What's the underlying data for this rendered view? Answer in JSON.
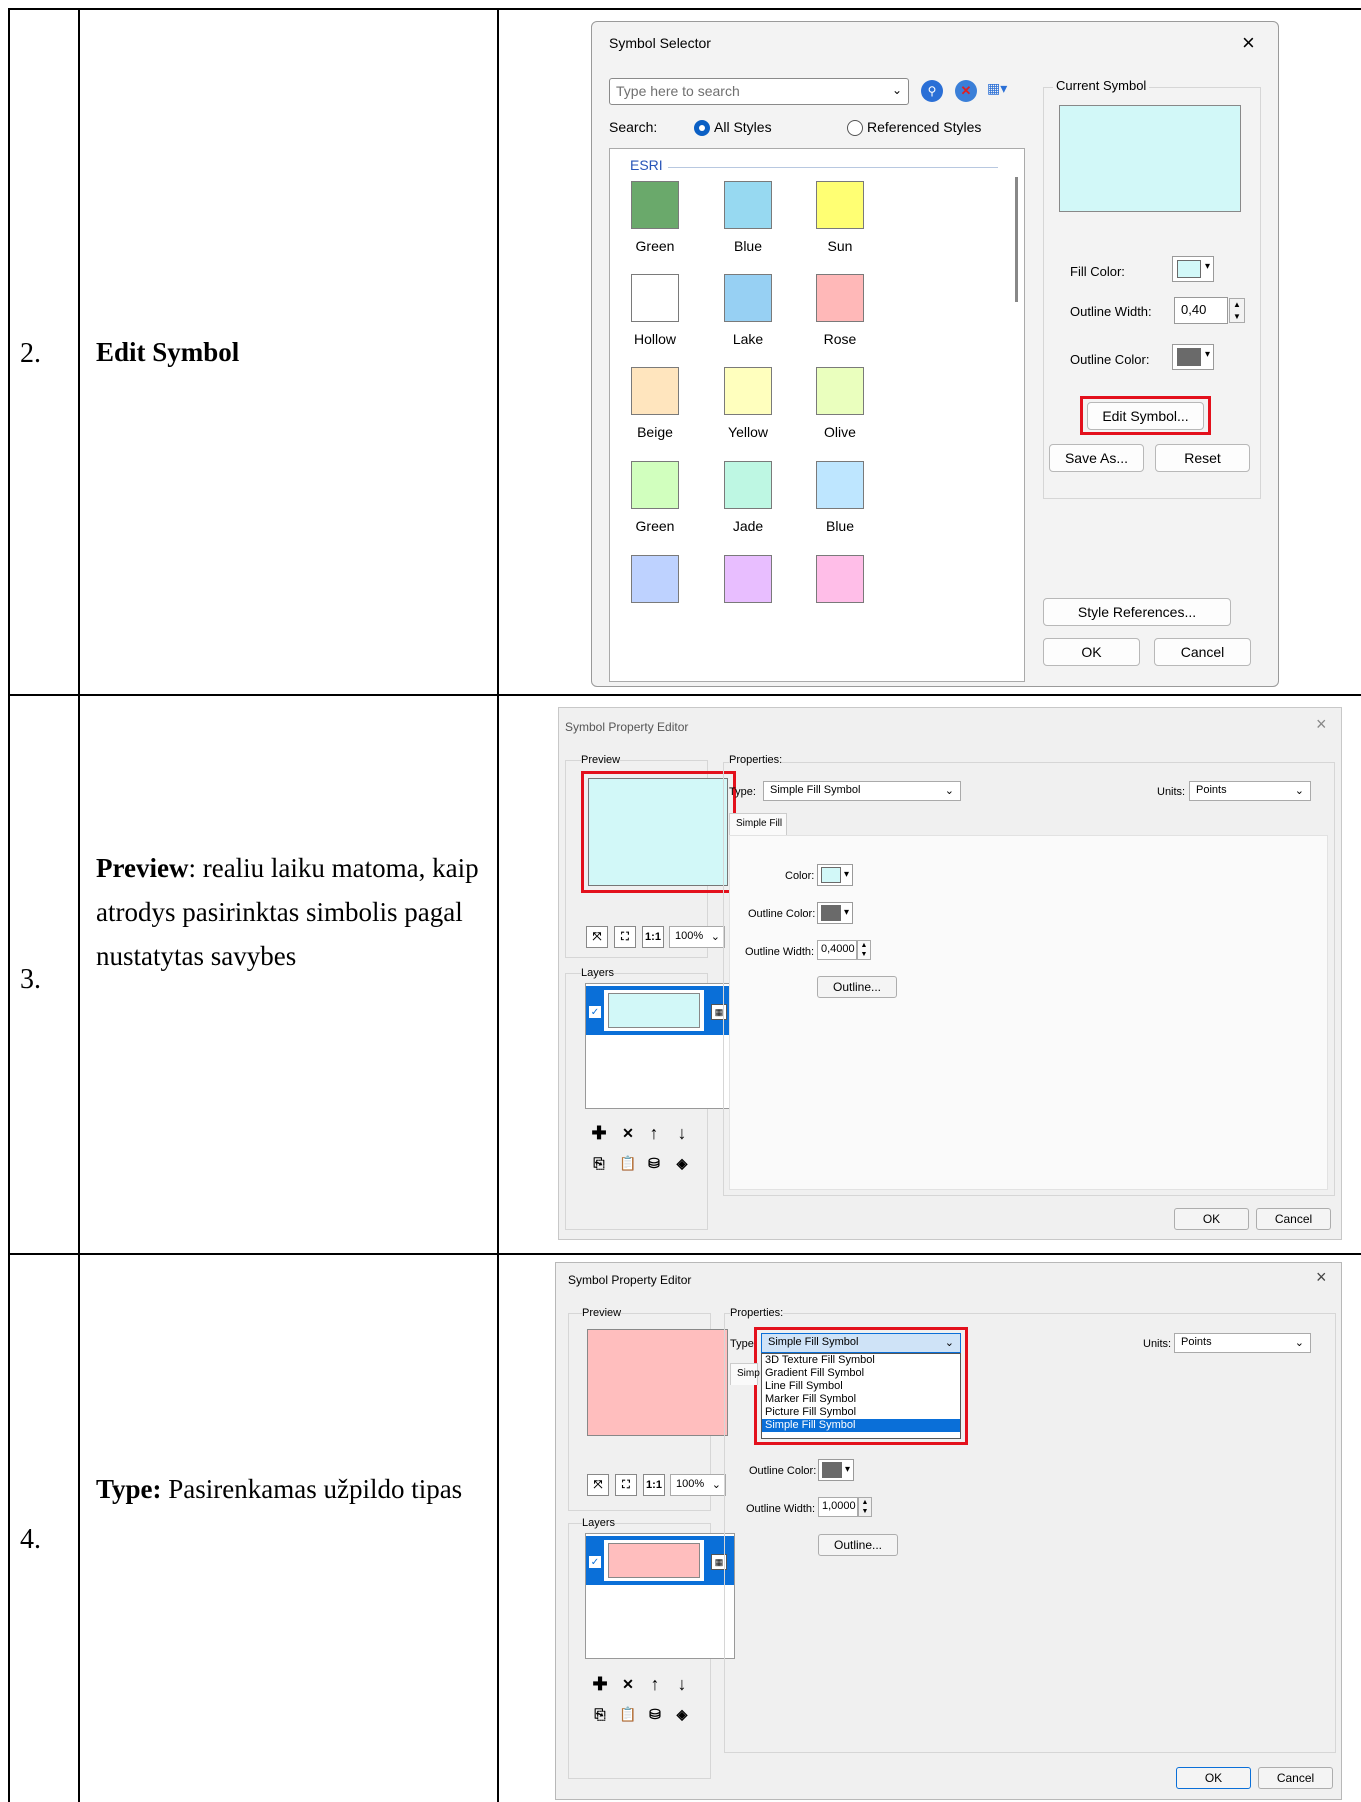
{
  "rows": [
    {
      "number": "2.",
      "title": "Edit Symbol",
      "text": ""
    },
    {
      "number": "3.",
      "title": "Preview",
      "text": ": realiu laiku matoma, kaip atrodys pasirinktas simbolis pagal nustatytas savybes"
    },
    {
      "number": "4.",
      "title": "Type:",
      "text": " Pasirenkamas užpildo tipas"
    }
  ],
  "symbol_selector": {
    "title": "Symbol Selector",
    "close": "×",
    "search_placeholder": "Type here to search",
    "search_label": "Search:",
    "opt_all": "All Styles",
    "opt_ref": "Referenced Styles",
    "group": "ESRI",
    "swatches": [
      {
        "label": "Green",
        "color": "#6aa96b"
      },
      {
        "label": "Blue",
        "color": "#97d9f1"
      },
      {
        "label": "Sun",
        "color": "#ffff73"
      },
      {
        "label": "Hollow",
        "color": "#ffffff"
      },
      {
        "label": "Lake",
        "color": "#97d0f3"
      },
      {
        "label": "Rose",
        "color": "#ffb8b8"
      },
      {
        "label": "Beige",
        "color": "#ffe5be"
      },
      {
        "label": "Yellow",
        "color": "#ffffbe"
      },
      {
        "label": "Olive",
        "color": "#eaffbe"
      },
      {
        "label": "Green",
        "color": "#d1ffbe"
      },
      {
        "label": "Jade",
        "color": "#bef7e3"
      },
      {
        "label": "Blue",
        "color": "#bee6ff"
      },
      {
        "label": "",
        "color": "#bed2ff"
      },
      {
        "label": "",
        "color": "#e8beff"
      },
      {
        "label": "",
        "color": "#ffbee8"
      }
    ],
    "current_symbol": "Current Symbol",
    "current_color": "#d2f8f8",
    "fill_color": "Fill Color:",
    "outline_width": "Outline Width:",
    "outline_width_value": "0,40",
    "outline_color": "Outline Color:",
    "edit_symbol": "Edit Symbol...",
    "save_as": "Save As...",
    "reset": "Reset",
    "style_refs": "Style References...",
    "ok": "OK",
    "cancel": "Cancel"
  },
  "editor1": {
    "title": "Symbol Property Editor",
    "close": "×",
    "preview": "Preview",
    "properties": "Properties:",
    "type_label": "Type:",
    "type_value": "Simple Fill Symbol",
    "units_label": "Units:",
    "units_value": "Points",
    "tab": "Simple Fill",
    "color_label": "Color:",
    "outline_color_label": "Outline Color:",
    "outline_width_label": "Outline Width:",
    "outline_width_value": "0,4000",
    "outline_btn": "Outline...",
    "zoom": "100%",
    "layers": "Layers",
    "ok": "OK",
    "cancel": "Cancel",
    "fill": "#d2f8f8"
  },
  "editor2": {
    "title": "Symbol Property Editor",
    "close": "×",
    "preview": "Preview",
    "properties": "Properties:",
    "type_label": "Type:",
    "type_value": "Simple Fill Symbol",
    "units_label": "Units:",
    "units_value": "Points",
    "tab": "Simp",
    "dropdown": [
      "3D Texture Fill Symbol",
      "Gradient Fill Symbol",
      "Line Fill Symbol",
      "Marker Fill Symbol",
      "Picture Fill Symbol",
      "Simple Fill Symbol"
    ],
    "outline_color_label": "Outline Color:",
    "outline_width_label": "Outline Width:",
    "outline_width_value": "1,0000",
    "outline_btn": "Outline...",
    "zoom": "100%",
    "layers": "Layers",
    "ok": "OK",
    "cancel": "Cancel",
    "fill": "#ffbebe"
  }
}
